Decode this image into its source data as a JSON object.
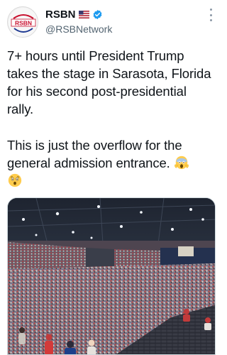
{
  "author": {
    "display_name": "RSBN",
    "handle": "@RSBNetwork",
    "avatar_text": "RSBN",
    "flag_icon": "us-flag-icon",
    "verified_icon": "verified-badge-icon"
  },
  "tweet": {
    "paragraph_1": "7+ hours until President Trump takes the stage in Sarasota, Florida for his second post-presidential rally.",
    "paragraph_2": "This is just the overflow for the general admission entrance.",
    "emojis": [
      "face-screaming-in-fear-emoji",
      "astonished-face-emoji"
    ]
  },
  "media": {
    "kind": "photo",
    "subject": "crowd-in-arena-photo"
  },
  "colors": {
    "verified_blue": "#1d9bf0",
    "text_primary": "#0f1419",
    "text_secondary": "#536471",
    "brand_red": "#c8102e"
  }
}
